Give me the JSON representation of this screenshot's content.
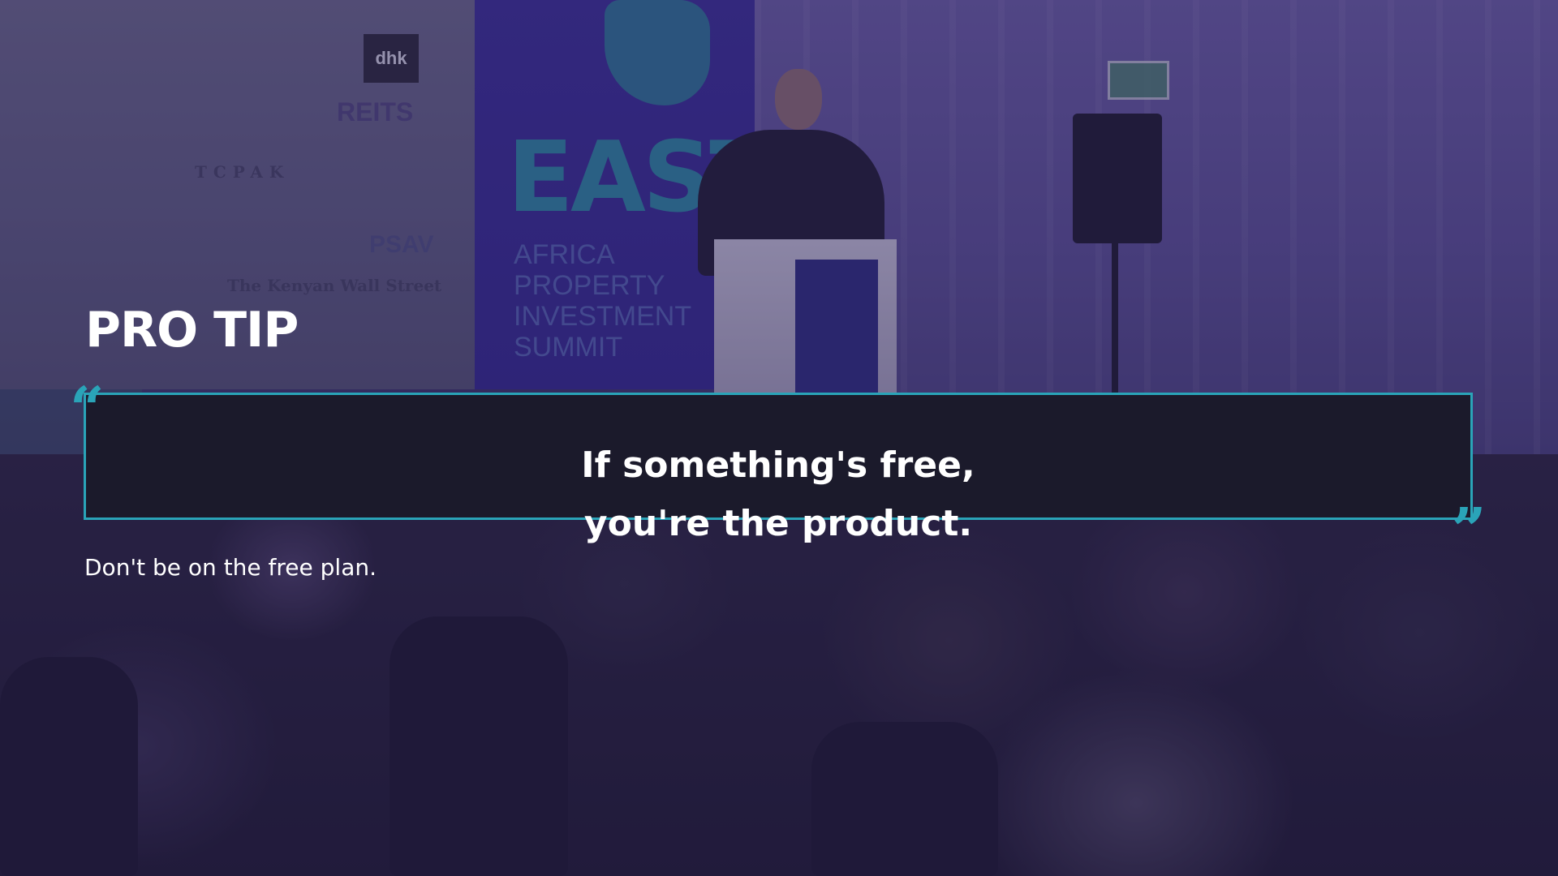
{
  "slide": {
    "title": "PRO TIP",
    "quote": "If something's free, you're the product.",
    "subtitle": "Don't be on the free plan."
  },
  "background_photo": {
    "banner_heading": "EAST",
    "banner_subtitle_line1": "AFRICA PROPERTY",
    "banner_subtitle_line2": "INVESTMENT SUMMIT",
    "sponsor_logos": [
      "dhk",
      "REITS",
      "TCPAK",
      "PSAV",
      "The Kenyan Wall Street"
    ]
  },
  "colors": {
    "accent": "#2aa4b8",
    "quote_box_background": "#1b1a2b",
    "text": "#ffffff",
    "overlay_tint": "#281e5a"
  },
  "icons": {
    "open_quote": "open-quote-icon",
    "close_quote": "close-quote-icon"
  }
}
